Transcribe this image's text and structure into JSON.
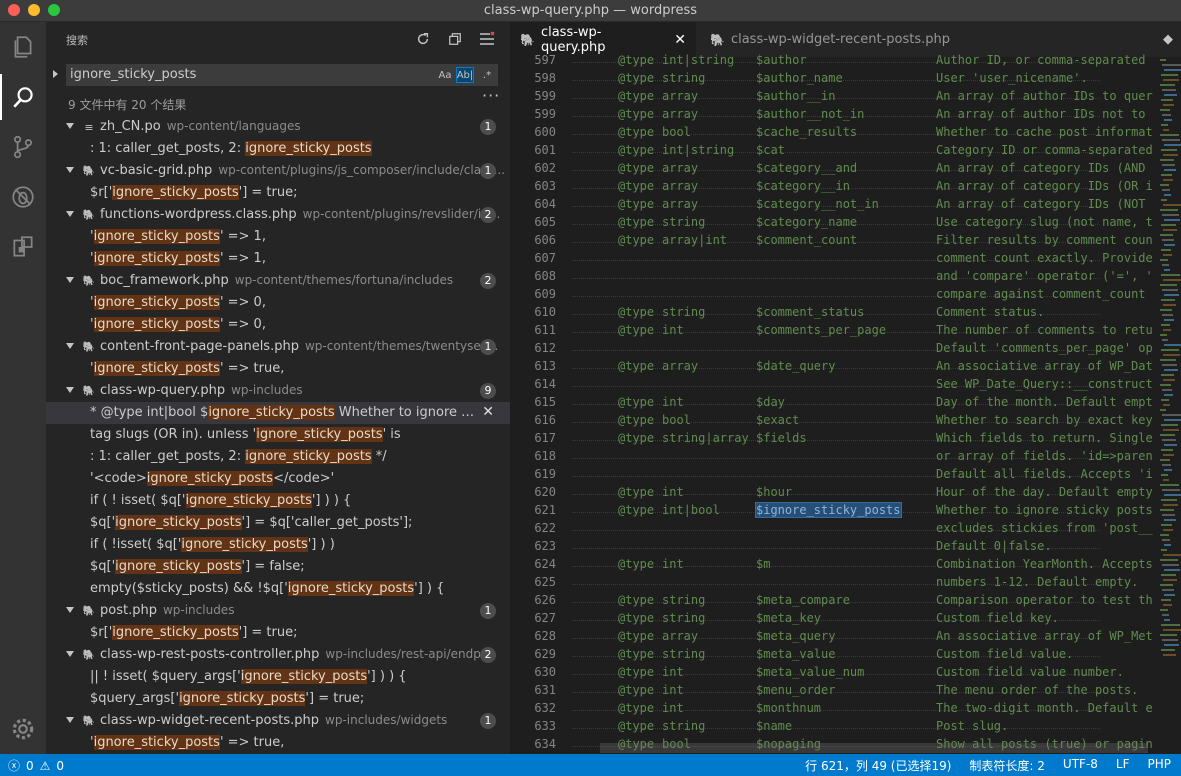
{
  "window": {
    "title": "class-wp-query.php — wordpress"
  },
  "sidebar": {
    "title": "搜索",
    "search_value": "ignore_sticky_posts",
    "options": {
      "case": "Aa",
      "word": "Ab|",
      "regex": ".*"
    },
    "result_summary": "9 文件中有 20 个结果",
    "files": [
      {
        "name": "zh_CN.po",
        "path": "wp-content/languages",
        "count": "1",
        "icon": "list-icon",
        "matches": [
          {
            "pre": ": 1: caller_get_posts, 2: ",
            "hit": "ignore_sticky_posts",
            "post": ""
          }
        ]
      },
      {
        "name": "vc-basic-grid.php",
        "path": "wp-content/plugins/js_composer/include/class...",
        "count": "1",
        "icon": "php-icon",
        "matches": [
          {
            "pre": "$r['",
            "hit": "ignore_sticky_posts",
            "post": "'] = true;"
          }
        ]
      },
      {
        "name": "functions-wordpress.class.php",
        "path": "wp-content/plugins/revslider/in...",
        "count": "2",
        "icon": "php-icon",
        "matches": [
          {
            "pre": "'",
            "hit": "ignore_sticky_posts",
            "post": "' => 1,"
          },
          {
            "pre": "'",
            "hit": "ignore_sticky_posts",
            "post": "' => 1,"
          }
        ]
      },
      {
        "name": "boc_framework.php",
        "path": "wp-content/themes/fortuna/includes",
        "count": "2",
        "icon": "php-icon",
        "matches": [
          {
            "pre": "'",
            "hit": "ignore_sticky_posts",
            "post": "' => 0,"
          },
          {
            "pre": "'",
            "hit": "ignore_sticky_posts",
            "post": "' => 0,"
          }
        ]
      },
      {
        "name": "content-front-page-panels.php",
        "path": "wp-content/themes/twentysev...",
        "count": "1",
        "icon": "php-icon",
        "matches": [
          {
            "pre": "'",
            "hit": "ignore_sticky_posts",
            "post": "' => true,"
          }
        ]
      },
      {
        "name": "class-wp-query.php",
        "path": "wp-includes",
        "count": "9",
        "icon": "php-icon",
        "matches": [
          {
            "pre": "* @type int|bool $",
            "hit": "ignore_sticky_posts",
            "post": " Whether to ignore stic...",
            "selected": true
          },
          {
            "pre": "tag slugs (OR in). unless '",
            "hit": "ignore_sticky_posts",
            "post": "' is"
          },
          {
            "pre": ": 1: caller_get_posts, 2: ",
            "hit": "ignore_sticky_posts",
            "post": " */"
          },
          {
            "pre": "'<code>",
            "hit": "ignore_sticky_posts",
            "post": "</code>'"
          },
          {
            "pre": "if ( ! isset( $q['",
            "hit": "ignore_sticky_posts",
            "post": "'] ) ) {"
          },
          {
            "pre": "$q['",
            "hit": "ignore_sticky_posts",
            "post": "'] = $q['caller_get_posts'];"
          },
          {
            "pre": "if ( !isset( $q['",
            "hit": "ignore_sticky_posts",
            "post": "'] ) )"
          },
          {
            "pre": "$q['",
            "hit": "ignore_sticky_posts",
            "post": "'] = false;"
          },
          {
            "pre": "empty($sticky_posts) && !$q['",
            "hit": "ignore_sticky_posts",
            "post": "'] ) {"
          }
        ]
      },
      {
        "name": "post.php",
        "path": "wp-includes",
        "count": "1",
        "icon": "php-icon",
        "matches": [
          {
            "pre": "$r['",
            "hit": "ignore_sticky_posts",
            "post": "'] = true;"
          }
        ]
      },
      {
        "name": "class-wp-rest-posts-controller.php",
        "path": "wp-includes/rest-api/endp...",
        "count": "2",
        "icon": "php-icon",
        "matches": [
          {
            "pre": "|| ! isset( $query_args['",
            "hit": "ignore_sticky_posts",
            "post": "'] ) ) {"
          },
          {
            "pre": "$query_args['",
            "hit": "ignore_sticky_posts",
            "post": "'] = true;"
          }
        ]
      },
      {
        "name": "class-wp-widget-recent-posts.php",
        "path": "wp-includes/widgets",
        "count": "1",
        "icon": "php-icon",
        "matches": [
          {
            "pre": "'",
            "hit": "ignore_sticky_posts",
            "post": "' => true,"
          }
        ]
      }
    ]
  },
  "tabs": [
    {
      "label": "class-wp-query.php",
      "active": true
    },
    {
      "label": "class-wp-widget-recent-posts.php",
      "active": false
    }
  ],
  "code_lines": [
    {
      "n": "597",
      "tag": "@type",
      "type": "int|string",
      "var": "$author",
      "desc": "Author ID, or comma-separated"
    },
    {
      "n": "598",
      "tag": "@type",
      "type": "string",
      "var": "$author_name",
      "desc": "User 'user_nicename'."
    },
    {
      "n": "599",
      "tag": "@type",
      "type": "array",
      "var": "$author__in",
      "desc": "An array of author IDs to quer"
    },
    {
      "n": "599",
      "tag": "@type",
      "type": "array",
      "var": "$author__not_in",
      "desc": "An array of author IDs not to"
    },
    {
      "n": "600",
      "tag": "@type",
      "type": "bool",
      "var": "$cache_results",
      "desc": "Whether to cache post informat"
    },
    {
      "n": "601",
      "tag": "@type",
      "type": "int|string",
      "var": "$cat",
      "desc": "Category ID or comma-separated"
    },
    {
      "n": "602",
      "tag": "@type",
      "type": "array",
      "var": "$category__and",
      "desc": "An array of category IDs (AND"
    },
    {
      "n": "603",
      "tag": "@type",
      "type": "array",
      "var": "$category__in",
      "desc": "An array of category IDs (OR i"
    },
    {
      "n": "604",
      "tag": "@type",
      "type": "array",
      "var": "$category__not_in",
      "desc": "An array of category IDs (NOT"
    },
    {
      "n": "605",
      "tag": "@type",
      "type": "string",
      "var": "$category_name",
      "desc": "Use category slug (not name, t"
    },
    {
      "n": "606",
      "tag": "@type",
      "type": "array|int",
      "var": "$comment_count",
      "desc": "Filter results by comment coun"
    },
    {
      "n": "607",
      "tag": "",
      "type": "",
      "var": "",
      "desc": "comment count exactly. Provide"
    },
    {
      "n": "608",
      "tag": "",
      "type": "",
      "var": "",
      "desc": "and 'compare' operator ('=', '"
    },
    {
      "n": "609",
      "tag": "",
      "type": "",
      "var": "",
      "desc": "compare against comment_count"
    },
    {
      "n": "610",
      "tag": "@type",
      "type": "string",
      "var": "$comment_status",
      "desc": "Comment status."
    },
    {
      "n": "611",
      "tag": "@type",
      "type": "int",
      "var": "$comments_per_page",
      "desc": "The number of comments to retu"
    },
    {
      "n": "612",
      "tag": "",
      "type": "",
      "var": "",
      "desc": "Default 'comments_per_page' op"
    },
    {
      "n": "613",
      "tag": "@type",
      "type": "array",
      "var": "$date_query",
      "desc": "An associative array of WP_Dat"
    },
    {
      "n": "614",
      "tag": "",
      "type": "",
      "var": "",
      "desc": "See WP_Date_Query::__construct"
    },
    {
      "n": "615",
      "tag": "@type",
      "type": "int",
      "var": "$day",
      "desc": "Day of the month. Default empt"
    },
    {
      "n": "616",
      "tag": "@type",
      "type": "bool",
      "var": "$exact",
      "desc": "Whether to search by exact key"
    },
    {
      "n": "617",
      "tag": "@type",
      "type": "string|array",
      "var": "$fields",
      "desc": "Which fields to return. Single"
    },
    {
      "n": "618",
      "tag": "",
      "type": "",
      "var": "",
      "desc": "or array of fields. 'id=>paren"
    },
    {
      "n": "619",
      "tag": "",
      "type": "",
      "var": "",
      "desc": "Default all fields. Accepts 'i"
    },
    {
      "n": "620",
      "tag": "@type",
      "type": "int",
      "var": "$hour",
      "desc": "Hour of the day. Default empty"
    },
    {
      "n": "621",
      "tag": "@type",
      "type": "int|bool",
      "var": "$ignore_sticky_posts",
      "desc": "Whether to ignore sticky posts",
      "found": true
    },
    {
      "n": "622",
      "tag": "",
      "type": "",
      "var": "",
      "desc": "excludes stickies from 'post__"
    },
    {
      "n": "623",
      "tag": "",
      "type": "",
      "var": "",
      "desc": "Default 0|false."
    },
    {
      "n": "624",
      "tag": "@type",
      "type": "int",
      "var": "$m",
      "desc": "Combination YearMonth. Accepts"
    },
    {
      "n": "625",
      "tag": "",
      "type": "",
      "var": "",
      "desc": "numbers 1-12. Default empty."
    },
    {
      "n": "626",
      "tag": "@type",
      "type": "string",
      "var": "$meta_compare",
      "desc": "Comparison operator to test th"
    },
    {
      "n": "627",
      "tag": "@type",
      "type": "string",
      "var": "$meta_key",
      "desc": "Custom field key."
    },
    {
      "n": "628",
      "tag": "@type",
      "type": "array",
      "var": "$meta_query",
      "desc": "An associative array of WP_Met"
    },
    {
      "n": "629",
      "tag": "@type",
      "type": "string",
      "var": "$meta_value",
      "desc": "Custom field value."
    },
    {
      "n": "630",
      "tag": "@type",
      "type": "int",
      "var": "$meta_value_num",
      "desc": "Custom field value number."
    },
    {
      "n": "631",
      "tag": "@type",
      "type": "int",
      "var": "$menu_order",
      "desc": "The menu order of the posts."
    },
    {
      "n": "632",
      "tag": "@type",
      "type": "int",
      "var": "$monthnum",
      "desc": "The two-digit month. Default e"
    },
    {
      "n": "633",
      "tag": "@type",
      "type": "string",
      "var": "$name",
      "desc": "Post slug."
    },
    {
      "n": "634",
      "tag": "@type",
      "type": "bool",
      "var": "$nopaging",
      "desc": "Show all posts (true) or pagin"
    }
  ],
  "statusbar": {
    "errors": "0",
    "warnings": "0",
    "position": "行 621，列 49 (已选择19)",
    "tab_size": "制表符长度: 2",
    "encoding": "UTF-8",
    "eol": "LF",
    "language": "PHP"
  },
  "colors": {
    "accent": "#007acc",
    "match_highlight": "#623315",
    "selection": "#264f78"
  }
}
